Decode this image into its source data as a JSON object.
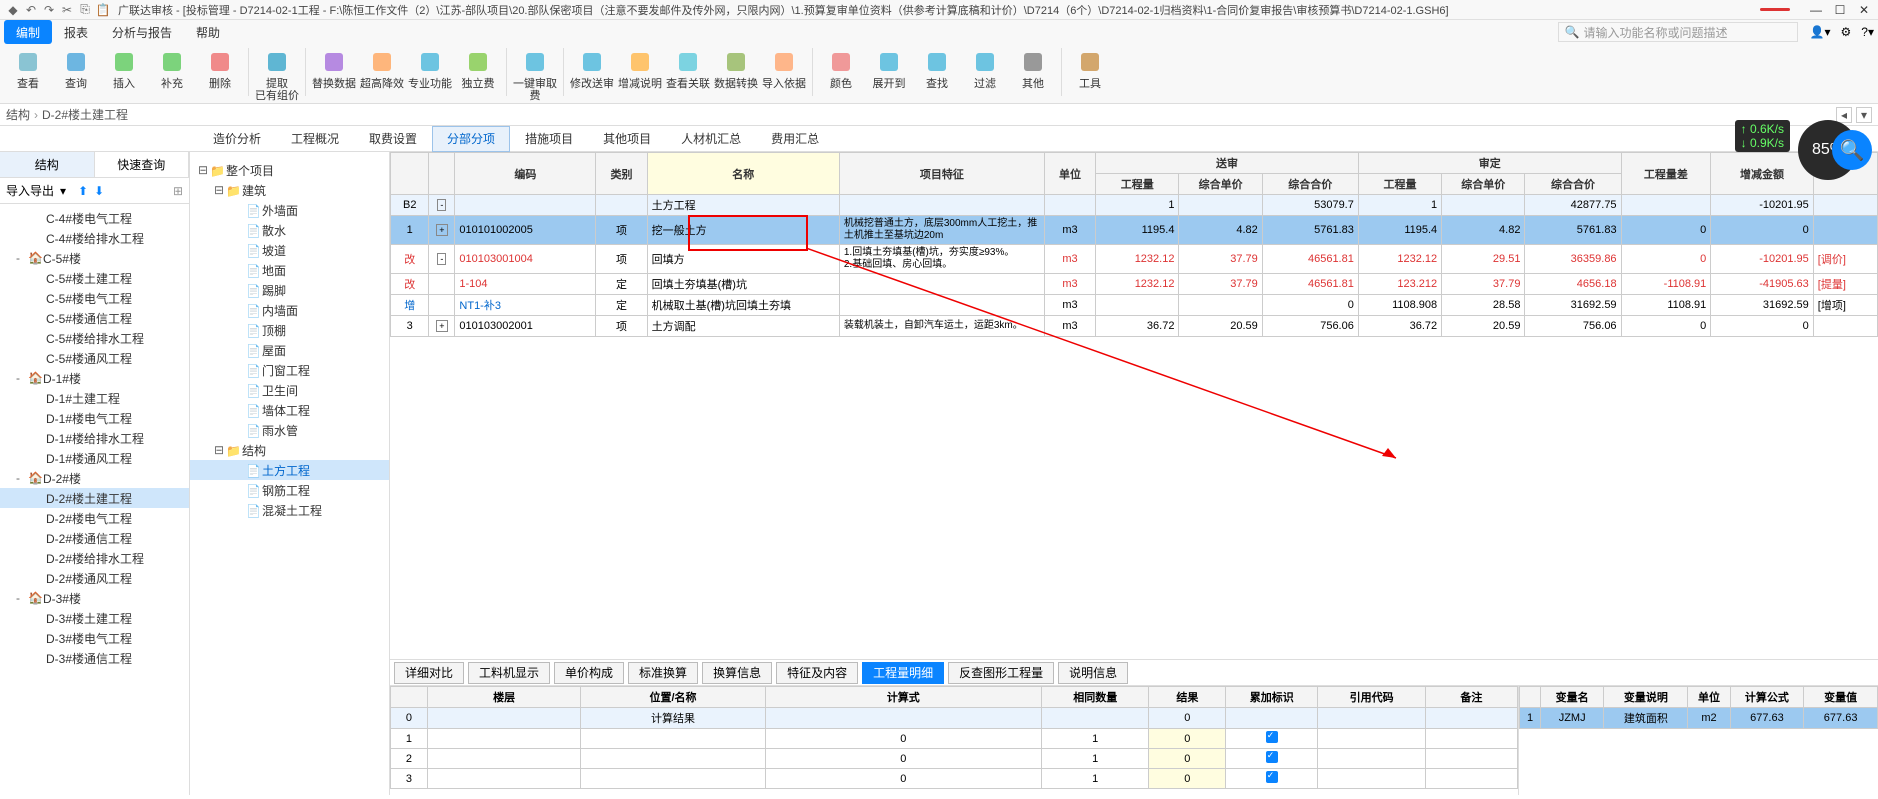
{
  "title": "广联达审核 - [投标管理 - D7214-02-1工程 - F:\\陈恒工作文件（2）\\江苏-部队项目\\20.部队保密项目（注意不要发邮件及传外网，只限内网）\\1.预算复审单位资料（供参考计算底稿和计价）\\D7214（6个）\\D7214-02-1归档资料\\1-合同价复审报告\\审核预算书\\D7214-02-1.GSH6]",
  "menubar": {
    "tabs": [
      "编制",
      "报表",
      "分析与报告",
      "帮助"
    ],
    "search_placeholder": "请输入功能名称或问题描述"
  },
  "ribbon": [
    {
      "label": "查看"
    },
    {
      "label": "查询"
    },
    {
      "label": "插入"
    },
    {
      "label": "补充"
    },
    {
      "label": "删除"
    },
    {
      "label": "提取",
      "sub": "已有组价"
    },
    {
      "label": "替换数据"
    },
    {
      "label": "超高降效"
    },
    {
      "label": "专业功能"
    },
    {
      "label": "独立费"
    },
    {
      "label": "一键审取费"
    },
    {
      "label": "修改送审"
    },
    {
      "label": "增减说明"
    },
    {
      "label": "查看关联"
    },
    {
      "label": "数据转换"
    },
    {
      "label": "导入依据"
    },
    {
      "label": "颜色"
    },
    {
      "label": "展开到"
    },
    {
      "label": "查找"
    },
    {
      "label": "过滤"
    },
    {
      "label": "其他"
    },
    {
      "label": "工具"
    }
  ],
  "breadcrumb": {
    "a": "结构",
    "b": "D-2#楼土建工程"
  },
  "subtabs": [
    "造价分析",
    "工程概况",
    "取费设置",
    "分部分项",
    "措施项目",
    "其他项目",
    "人材机汇总",
    "费用汇总"
  ],
  "subtab_active": 3,
  "left_tabs": [
    "结构",
    "快速查询"
  ],
  "left_toolbar": {
    "label": "导入导出"
  },
  "left_tree": [
    {
      "t": "C-4#楼电气工程",
      "lvl": 2
    },
    {
      "t": "C-4#楼给排水工程",
      "lvl": 2
    },
    {
      "t": "C-5#楼",
      "lvl": 1,
      "tog": "-"
    },
    {
      "t": "C-5#楼土建工程",
      "lvl": 2
    },
    {
      "t": "C-5#楼电气工程",
      "lvl": 2
    },
    {
      "t": "C-5#楼通信工程",
      "lvl": 2
    },
    {
      "t": "C-5#楼给排水工程",
      "lvl": 2
    },
    {
      "t": "C-5#楼通风工程",
      "lvl": 2
    },
    {
      "t": "D-1#楼",
      "lvl": 1,
      "tog": "-"
    },
    {
      "t": "D-1#土建工程",
      "lvl": 2
    },
    {
      "t": "D-1#楼电气工程",
      "lvl": 2
    },
    {
      "t": "D-1#楼给排水工程",
      "lvl": 2
    },
    {
      "t": "D-1#楼通风工程",
      "lvl": 2
    },
    {
      "t": "D-2#楼",
      "lvl": 1,
      "tog": "-"
    },
    {
      "t": "D-2#楼土建工程",
      "lvl": 2,
      "sel": true
    },
    {
      "t": "D-2#楼电气工程",
      "lvl": 2
    },
    {
      "t": "D-2#楼通信工程",
      "lvl": 2
    },
    {
      "t": "D-2#楼给排水工程",
      "lvl": 2
    },
    {
      "t": "D-2#楼通风工程",
      "lvl": 2
    },
    {
      "t": "D-3#楼",
      "lvl": 1,
      "tog": "-"
    },
    {
      "t": "D-3#楼土建工程",
      "lvl": 2
    },
    {
      "t": "D-3#楼电气工程",
      "lvl": 2
    },
    {
      "t": "D-3#楼通信工程",
      "lvl": 2
    }
  ],
  "mid_tree": [
    {
      "t": "整个项目",
      "lvl": 0,
      "tog": "-",
      "ic": "folder"
    },
    {
      "t": "建筑",
      "lvl": 1,
      "tog": "-",
      "ic": "folder"
    },
    {
      "t": "外墙面",
      "lvl": 2,
      "ic": "doc"
    },
    {
      "t": "散水",
      "lvl": 2,
      "ic": "doc"
    },
    {
      "t": "坡道",
      "lvl": 2,
      "ic": "doc"
    },
    {
      "t": "地面",
      "lvl": 2,
      "ic": "doc"
    },
    {
      "t": "踢脚",
      "lvl": 2,
      "ic": "doc"
    },
    {
      "t": "内墙面",
      "lvl": 2,
      "ic": "doc"
    },
    {
      "t": "顶棚",
      "lvl": 2,
      "ic": "doc"
    },
    {
      "t": "屋面",
      "lvl": 2,
      "ic": "doc"
    },
    {
      "t": "门窗工程",
      "lvl": 2,
      "ic": "doc"
    },
    {
      "t": "卫生间",
      "lvl": 2,
      "ic": "doc"
    },
    {
      "t": "墙体工程",
      "lvl": 2,
      "ic": "doc"
    },
    {
      "t": "雨水管",
      "lvl": 2,
      "ic": "doc"
    },
    {
      "t": "结构",
      "lvl": 1,
      "tog": "-",
      "ic": "folder"
    },
    {
      "t": "土方工程",
      "lvl": 2,
      "ic": "doc",
      "sel": true
    },
    {
      "t": "钢筋工程",
      "lvl": 2,
      "ic": "doc"
    },
    {
      "t": "混凝土工程",
      "lvl": 2,
      "ic": "doc"
    }
  ],
  "grid_headers": {
    "c1": "",
    "c2": "编码",
    "c3": "类别",
    "c4": "名称",
    "c5": "项目特征",
    "c6": "单位",
    "g1": "送审",
    "g2": "审定",
    "g1a": "工程量",
    "g1b": "综合单价",
    "g1c": "综合合价",
    "g2a": "工程量",
    "g2b": "综合单价",
    "g2c": "综合合价",
    "c7": "工程量差",
    "c8": "增减金额"
  },
  "grid_rows": [
    {
      "idx": "B2",
      "tog": "-",
      "code": "",
      "cat": "",
      "name": "土方工程",
      "feat": "",
      "unit": "",
      "sa": "1",
      "sb": "",
      "sc": "53079.7",
      "da": "1",
      "db": "",
      "dc": "42877.75",
      "diff": "",
      "delta": "-10201.95",
      "cls": "row-b2"
    },
    {
      "idx": "1",
      "tog": "+",
      "code": "010101002005",
      "cat": "项",
      "name": "挖一般土方",
      "feat": "机械挖普通土方，底层300mm人工挖土，推土机推土至基坑边20m",
      "unit": "m3",
      "sa": "1195.4",
      "sb": "4.82",
      "sc": "5761.83",
      "da": "1195.4",
      "db": "4.82",
      "dc": "5761.83",
      "diff": "0",
      "delta": "0",
      "cls": "row-sel"
    },
    {
      "idx": "改",
      "tog": "-",
      "code": "010103001004",
      "cat": "项",
      "name": "回填方",
      "feat": "1.回填土夯填基(槽)坑，夯实度≥93%。\n2.基础回填、房心回填。",
      "unit": "m3",
      "sa": "1232.12",
      "sb": "37.79",
      "sc": "46561.81",
      "da": "1232.12",
      "db": "29.51",
      "dc": "36359.86",
      "diff": "0",
      "delta": "-10201.95",
      "note": "[调价]",
      "chg": true
    },
    {
      "idx": "改",
      "tog": "",
      "code": "1-104",
      "cat": "定",
      "name": "回填土夯填基(槽)坑",
      "feat": "",
      "unit": "m3",
      "sa": "1232.12",
      "sb": "37.79",
      "sc": "46561.81",
      "da": "123.212",
      "db": "37.79",
      "dc": "4656.18",
      "diff": "-1108.91",
      "delta": "-41905.63",
      "note": "[提量]",
      "chg": true,
      "da_red": true
    },
    {
      "idx": "增",
      "tog": "",
      "code": "NT1-补3",
      "cat": "定",
      "name": "机械取土基(槽)坑回填土夯填",
      "feat": "",
      "unit": "m3",
      "sa": "",
      "sb": "",
      "sc": "0",
      "da": "1108.908",
      "db": "28.58",
      "dc": "31692.59",
      "diff": "1108.91",
      "delta": "31692.59",
      "note": "[增项]",
      "add": true
    },
    {
      "idx": "3",
      "tog": "+",
      "code": "010103002001",
      "cat": "项",
      "name": "土方调配",
      "feat": "装载机装土，自卸汽车运土，运距3km。",
      "unit": "m3",
      "sa": "36.72",
      "sb": "20.59",
      "sc": "756.06",
      "da": "36.72",
      "db": "20.59",
      "dc": "756.06",
      "diff": "0",
      "delta": "0"
    }
  ],
  "bottom_tabs": [
    "详细对比",
    "工料机显示",
    "单价构成",
    "标准换算",
    "换算信息",
    "特征及内容",
    "工程量明细",
    "反查图形工程量",
    "说明信息"
  ],
  "bottom_tab_active": 6,
  "detail_grid": {
    "headers": [
      "",
      "楼层",
      "位置/名称",
      "计算式",
      "相同数量",
      "结果",
      "累加标识",
      "引用代码",
      "备注"
    ],
    "rows": [
      {
        "i": "0",
        "floor": "",
        "name": "计算结果",
        "expr": "",
        "qty": "",
        "res": "0",
        "flag": false
      },
      {
        "i": "1",
        "floor": "",
        "name": "",
        "expr": "0",
        "qty": "1",
        "res": "0",
        "flag": true
      },
      {
        "i": "2",
        "floor": "",
        "name": "",
        "expr": "0",
        "qty": "1",
        "res": "0",
        "flag": true
      },
      {
        "i": "3",
        "floor": "",
        "name": "",
        "expr": "0",
        "qty": "1",
        "res": "0",
        "flag": true
      }
    ]
  },
  "var_grid": {
    "headers": [
      "",
      "变量名",
      "变量说明",
      "单位",
      "计算公式",
      "变量值"
    ],
    "rows": [
      {
        "i": "1",
        "name": "JZMJ",
        "desc": "建筑面积",
        "unit": "m2",
        "expr": "677.63",
        "val": "677.63"
      }
    ]
  },
  "gauge": {
    "pct": "85%",
    "up": "0.6K/s",
    "dn": "0.9K/s"
  }
}
